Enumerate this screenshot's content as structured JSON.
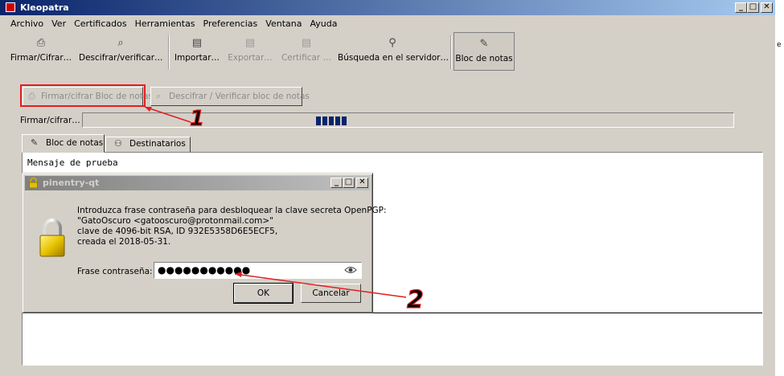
{
  "window": {
    "title": "Kleopatra",
    "min": "_",
    "max": "□",
    "close": "✕"
  },
  "menu": [
    "Archivo",
    "Ver",
    "Certificados",
    "Herramientas",
    "Preferencias",
    "Ventana",
    "Ayuda"
  ],
  "toolbar": {
    "sign_encrypt": "Firmar/Cifrar…",
    "decrypt_verify": "Descifrar/verificar…",
    "import": "Importar…",
    "export": "Exportar…",
    "certify": "Certificar …",
    "lookup": "Búsqueda en el servidor…",
    "notepad": "Bloc de notas"
  },
  "notepad": {
    "sign_button": "Firmar/cifrar Bloc de notas",
    "decrypt_button": "Descifrar / Verificar bloc de notas",
    "progress_label": "Firmar/cifrar…",
    "tab_notepad": "Bloc de notas",
    "tab_recipients": "Destinatarios",
    "message": "Mensaje de prueba"
  },
  "dialog": {
    "title": "pinentry-qt",
    "line1": "Introduzca frase contraseña para desbloquear la clave secreta OpenPGP:",
    "line2": "\"GatoOscuro <gatooscuro@protonmail.com>\"",
    "line3": "clave de 4096-bit RSA, ID 932E5358D6E5ECF5,",
    "line4": "creada el 2018-05-31.",
    "passphrase_label": "Frase contraseña:",
    "passphrase_value": "●●●●●●●●●●●",
    "ok": "OK",
    "cancel": "Cancelar"
  },
  "annotations": {
    "first": "1",
    "second": "2",
    "color": "#e02020"
  },
  "side_fragment": "e"
}
